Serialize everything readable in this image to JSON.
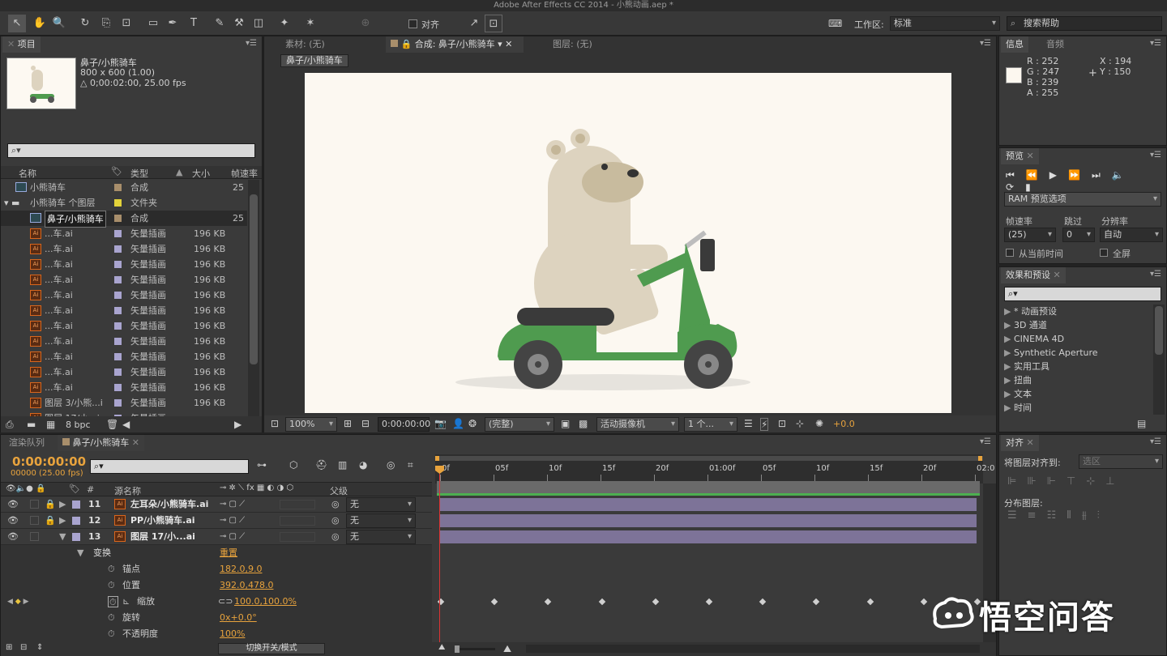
{
  "app_title": "Adobe After Effects CC 2014 - 小熊动画.aep *",
  "toolbar": {
    "align_label": "对齐",
    "workspace_label": "工作区:",
    "workspace_value": "标准",
    "search_placeholder": "搜索帮助"
  },
  "project": {
    "tab": "项目",
    "selected_name": "鼻子/小熊骑车",
    "selected_dim": "800 x 600 (1.00)",
    "selected_dur": "△ 0;00:02:00, 25.00 fps",
    "search_value": "",
    "columns": {
      "name": "名称",
      "type": "类型",
      "size": "大小",
      "fps": "帧速率"
    },
    "rows": [
      {
        "name": "小熊骑车",
        "type": "合成",
        "size": "",
        "fps": "25"
      },
      {
        "name": "小熊骑车 个图层",
        "type": "文件夹",
        "size": "",
        "fps": ""
      },
      {
        "name": "鼻子/小熊骑车",
        "type": "合成",
        "size": "",
        "fps": "25"
      },
      {
        "name": "...车.ai",
        "type": "矢量插画",
        "size": "196 KB",
        "fps": ""
      },
      {
        "name": "...车.ai",
        "type": "矢量插画",
        "size": "196 KB",
        "fps": ""
      },
      {
        "name": "...车.ai",
        "type": "矢量插画",
        "size": "196 KB",
        "fps": ""
      },
      {
        "name": "...车.ai",
        "type": "矢量插画",
        "size": "196 KB",
        "fps": ""
      },
      {
        "name": "...车.ai",
        "type": "矢量插画",
        "size": "196 KB",
        "fps": ""
      },
      {
        "name": "...车.ai",
        "type": "矢量插画",
        "size": "196 KB",
        "fps": ""
      },
      {
        "name": "...车.ai",
        "type": "矢量插画",
        "size": "196 KB",
        "fps": ""
      },
      {
        "name": "...车.ai",
        "type": "矢量插画",
        "size": "196 KB",
        "fps": ""
      },
      {
        "name": "...车.ai",
        "type": "矢量插画",
        "size": "196 KB",
        "fps": ""
      },
      {
        "name": "...车.ai",
        "type": "矢量插画",
        "size": "196 KB",
        "fps": ""
      },
      {
        "name": "...车.ai",
        "type": "矢量插画",
        "size": "196 KB",
        "fps": ""
      },
      {
        "name": "图层 3/小熊...i",
        "type": "矢量插画",
        "size": "196 KB",
        "fps": ""
      },
      {
        "name": "图层 17/小...i",
        "type": "矢量插画",
        "size": "",
        "fps": ""
      }
    ],
    "bpc": "8 bpc"
  },
  "viewer": {
    "tab_footage": "素材: (无)",
    "tab_comp": "合成: 鼻子/小熊骑车",
    "tab_layer": "图层: (无)",
    "breadcrumb": "鼻子/小熊骑车",
    "zoom": "100%",
    "timecode": "0:00:00:00",
    "quality": "(完整)",
    "camera": "活动摄像机",
    "views": "1 个...",
    "exposure": "+0.0"
  },
  "info": {
    "tab": "信息",
    "tab2": "音频",
    "r": "R : 252",
    "g": "G : 247",
    "b": "B : 239",
    "a": "A : 255",
    "x": "X : 194",
    "y": "Y : 150"
  },
  "preview": {
    "tab": "预览",
    "ram": "RAM 预览选项",
    "fps_label": "帧速率",
    "skip_label": "跳过",
    "res_label": "分辨率",
    "fps_value": "(25)",
    "skip_value": "0",
    "res_value": "自动",
    "from_current": "从当前时间",
    "fullscreen": "全屏"
  },
  "effects": {
    "tab": "效果和预设",
    "items": [
      "* 动画预设",
      "3D 通道",
      "CINEMA 4D",
      "Synthetic Aperture",
      "实用工具",
      "扭曲",
      "文本",
      "时间"
    ]
  },
  "align": {
    "tab": "对齐",
    "align_to": "将图层对齐到:",
    "align_to_value": "选区",
    "distribute": "分布图层:"
  },
  "timeline": {
    "tab_render": "渲染队列",
    "tab_comp": "鼻子/小熊骑车",
    "timecode": "0:00:00:00",
    "frames": "00000 (25.00 fps)",
    "col_source": "源名称",
    "col_parent": "父级",
    "layers": [
      {
        "num": "11",
        "name": "左耳朵/小熊骑车.ai",
        "parent": "无"
      },
      {
        "num": "12",
        "name": "PP/小熊骑车.ai",
        "parent": "无"
      },
      {
        "num": "13",
        "name": "图层 17/小...ai",
        "parent": "无"
      }
    ],
    "transform": "变换",
    "reset": "重置",
    "props": [
      {
        "name": "锚点",
        "value": "182.0,9.0"
      },
      {
        "name": "位置",
        "value": "392.0,478.0"
      },
      {
        "name": "缩放",
        "value": "100.0,100.0%"
      },
      {
        "name": "旋转",
        "value": "0x+0.0°"
      },
      {
        "name": "不透明度",
        "value": "100%"
      }
    ],
    "ruler": [
      "0f",
      "05f",
      "10f",
      "15f",
      "20f",
      "01:00f",
      "05f",
      "10f",
      "15f",
      "20f",
      "02:0"
    ],
    "toggle_label": "切换开关/模式"
  },
  "watermark": "悟空问答",
  "colors": {
    "accent": "#e8a33d",
    "layer_bar": "#7d7398",
    "label_purple": "#a9a4cf",
    "scooter_green": "#4f9b4f",
    "comp_bg": "#fcf8f1"
  }
}
